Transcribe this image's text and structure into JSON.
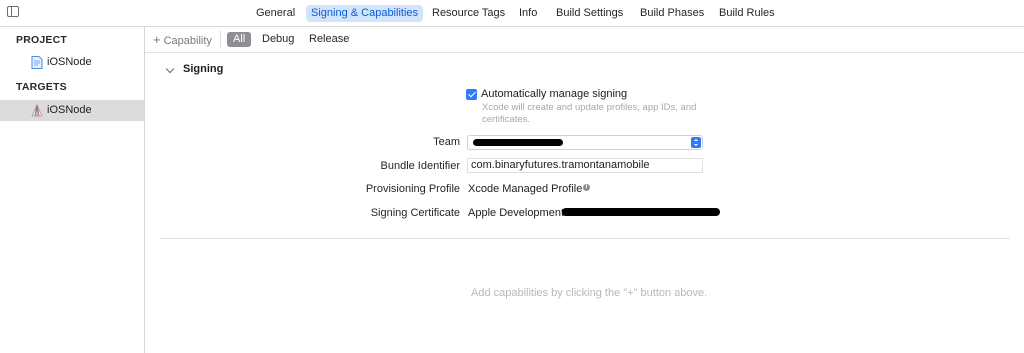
{
  "tabs": [
    {
      "label": "General",
      "active": false
    },
    {
      "label": "Signing & Capabilities",
      "active": true
    },
    {
      "label": "Resource Tags",
      "active": false
    },
    {
      "label": "Info",
      "active": false
    },
    {
      "label": "Build Settings",
      "active": false
    },
    {
      "label": "Build Phases",
      "active": false
    },
    {
      "label": "Build Rules",
      "active": false
    }
  ],
  "sidebar": {
    "project_header": "PROJECT",
    "project_item": "iOSNode",
    "targets_header": "TARGETS",
    "target_item": "iOSNode"
  },
  "filterbar": {
    "capability_label": "Capability",
    "segments": [
      "All",
      "Debug",
      "Release"
    ],
    "active_segment": "All"
  },
  "signing": {
    "section_title": "Signing",
    "auto_manage_label": "Automatically manage signing",
    "auto_manage_checked": true,
    "auto_manage_desc": "Xcode will create and update profiles, app IDs, and certificates.",
    "team_label": "Team",
    "bundle_label": "Bundle Identifier",
    "bundle_value": "com.binaryfutures.tramontanamobile",
    "profile_label": "Provisioning Profile",
    "profile_value": "Xcode Managed Profile",
    "cert_label": "Signing Certificate",
    "cert_value": "Apple Development:"
  },
  "empty_message": "Add capabilities by clicking the \"+\" button above.",
  "colors": {
    "accent": "#2f7cf6",
    "active_tab_bg": "#d2e4fb",
    "active_tab_text": "#0b5cd5"
  }
}
